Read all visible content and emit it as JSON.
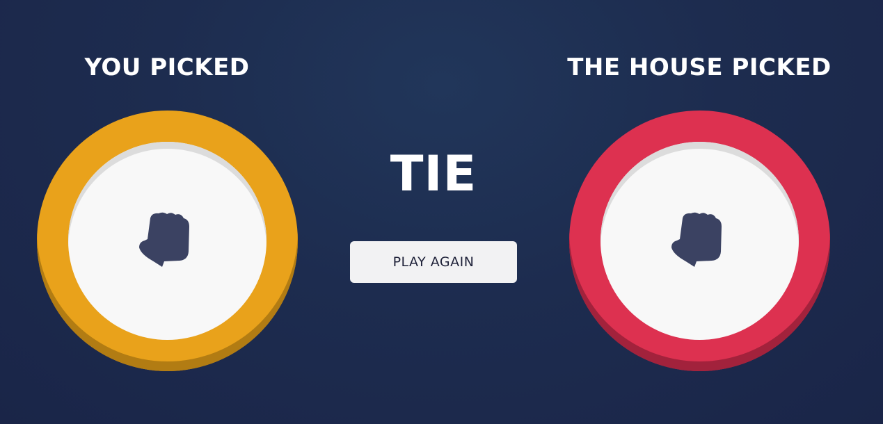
{
  "player": {
    "label": "YOU PICKED",
    "choice": "rock",
    "icon": "rock-fist-icon",
    "ring_color": "#e9a21b"
  },
  "house": {
    "label": "THE HOUSE PICKED",
    "choice": "rock",
    "icon": "rock-fist-icon",
    "ring_color": "#dd3150"
  },
  "result": {
    "text": "TIE"
  },
  "play_again": {
    "label": "PLAY AGAIN"
  },
  "colors": {
    "background": "#1f2e52",
    "icon": "#3b4262",
    "button": "#f2f2f3"
  }
}
